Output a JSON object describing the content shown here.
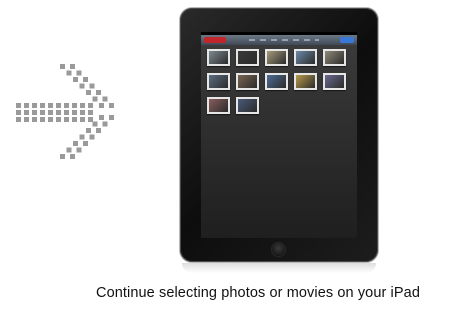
{
  "caption": "Continue selecting photos or movies on your iPad",
  "icons": {
    "arrow": "dotted-arrow-right-icon",
    "home_button": "home-button-icon"
  },
  "colors": {
    "arrow": "#9a9a9a",
    "device_bezel": "#111111",
    "nav_cancel": "#c2262b",
    "nav_done": "#3a78d8",
    "caption_text": "#111111"
  },
  "gallery": {
    "thumbnail_count": 12,
    "thumbnails": [
      {
        "color": "#7d8a92"
      },
      {
        "color": "#3a3a3a"
      },
      {
        "color": "#a59a7c"
      },
      {
        "color": "#6d8aa8"
      },
      {
        "color": "#8f8a78"
      },
      {
        "color": "#5b6d82"
      },
      {
        "color": "#7a6552"
      },
      {
        "color": "#4d6d96"
      },
      {
        "color": "#b89a4a"
      },
      {
        "color": "#6a6a8e"
      },
      {
        "color": "#8a5d5d"
      },
      {
        "color": "#4a5a7a"
      }
    ]
  }
}
